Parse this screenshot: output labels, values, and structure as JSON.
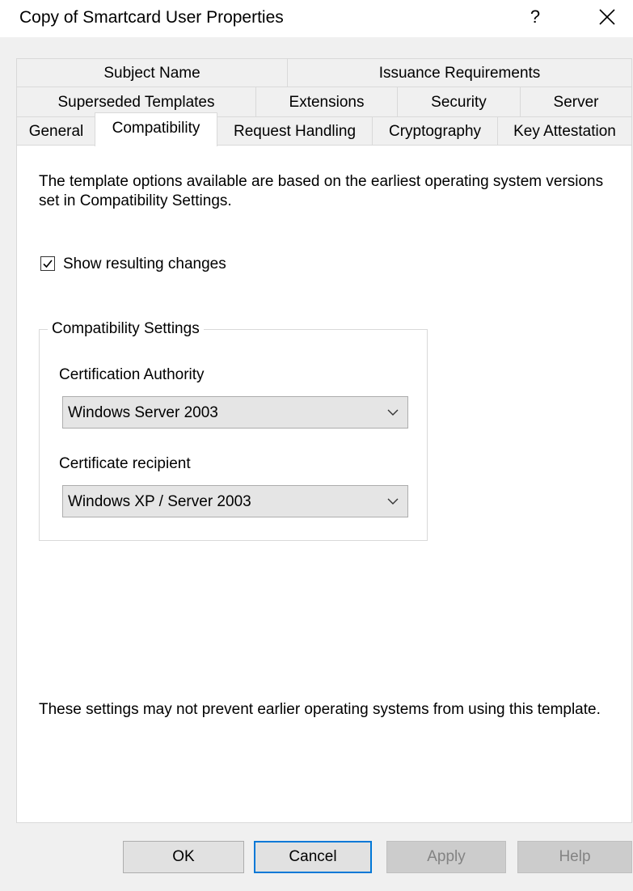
{
  "window": {
    "title": "Copy of Smartcard User Properties",
    "help_glyph": "?",
    "close_icon": "close-icon"
  },
  "tabs": {
    "row1": [
      {
        "label": "Subject Name"
      },
      {
        "label": "Issuance Requirements"
      }
    ],
    "row2": [
      {
        "label": "Superseded Templates"
      },
      {
        "label": "Extensions"
      },
      {
        "label": "Security"
      },
      {
        "label": "Server"
      }
    ],
    "row3": [
      {
        "label": "General"
      },
      {
        "label": "Compatibility",
        "active": true
      },
      {
        "label": "Request Handling"
      },
      {
        "label": "Cryptography"
      },
      {
        "label": "Key Attestation"
      }
    ]
  },
  "panel": {
    "description": "The template options available are based on the earliest operating system versions set in Compatibility Settings.",
    "show_changes_label": "Show resulting changes",
    "show_changes_checked": true,
    "group_title": "Compatibility Settings",
    "ca_label": "Certification Authority",
    "ca_value": "Windows Server 2003",
    "recipient_label": "Certificate recipient",
    "recipient_value": "Windows XP / Server 2003",
    "footnote": "These settings may not prevent earlier operating systems from using this template."
  },
  "buttons": {
    "ok": "OK",
    "cancel": "Cancel",
    "apply": "Apply",
    "help": "Help"
  },
  "colors": {
    "accent": "#0078d7",
    "window_bg": "#f0f0f0",
    "panel_bg": "#ffffff"
  }
}
